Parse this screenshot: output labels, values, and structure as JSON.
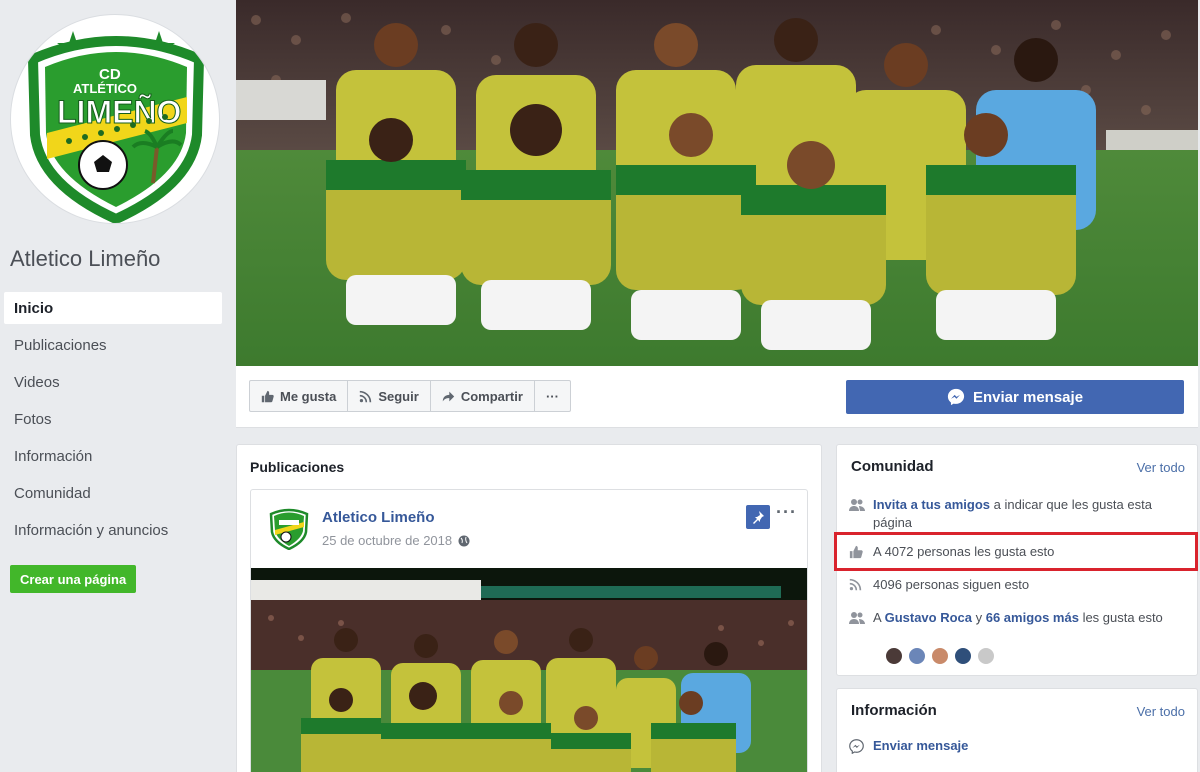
{
  "page": {
    "name": "Atletico Limeño",
    "logo": {
      "line1": "CD",
      "line2": "ATLÉTICO",
      "line3": "LIMEÑO"
    }
  },
  "nav": [
    {
      "label": "Inicio",
      "active": true
    },
    {
      "label": "Publicaciones"
    },
    {
      "label": "Videos"
    },
    {
      "label": "Fotos"
    },
    {
      "label": "Información"
    },
    {
      "label": "Comunidad"
    },
    {
      "label": "Información y anuncios"
    }
  ],
  "create_page_label": "Crear una página",
  "actions": {
    "like": "Me gusta",
    "follow": "Seguir",
    "share": "Compartir",
    "more": "···",
    "send_message": "Enviar mensaje"
  },
  "posts": {
    "title": "Publicaciones",
    "post": {
      "author": "Atletico Limeño",
      "date": "25 de octubre de 2018",
      "more": "···"
    }
  },
  "community": {
    "title": "Comunidad",
    "see_all": "Ver todo",
    "invite_bold": "Invita a tus amigos",
    "invite_rest": " a indicar que les gusta esta página",
    "likes": "A 4072 personas les gusta esto",
    "follows": "4096 personas siguen esto",
    "friends_pre": "A ",
    "friends_name": "Gustavo Roca",
    "friends_mid": " y ",
    "friends_count": "66 amigos más",
    "friends_post": " les gusta esto"
  },
  "info": {
    "title": "Información",
    "see_all": "Ver todo",
    "send_message": "Enviar mensaje"
  },
  "colors": {
    "facebook_blue": "#4267b2",
    "link_blue": "#365899",
    "green_button": "#42b72a",
    "highlight_red": "#d9232d",
    "jersey_green": "#1e7a2c",
    "jersey_yellow": "#c8c43a"
  }
}
